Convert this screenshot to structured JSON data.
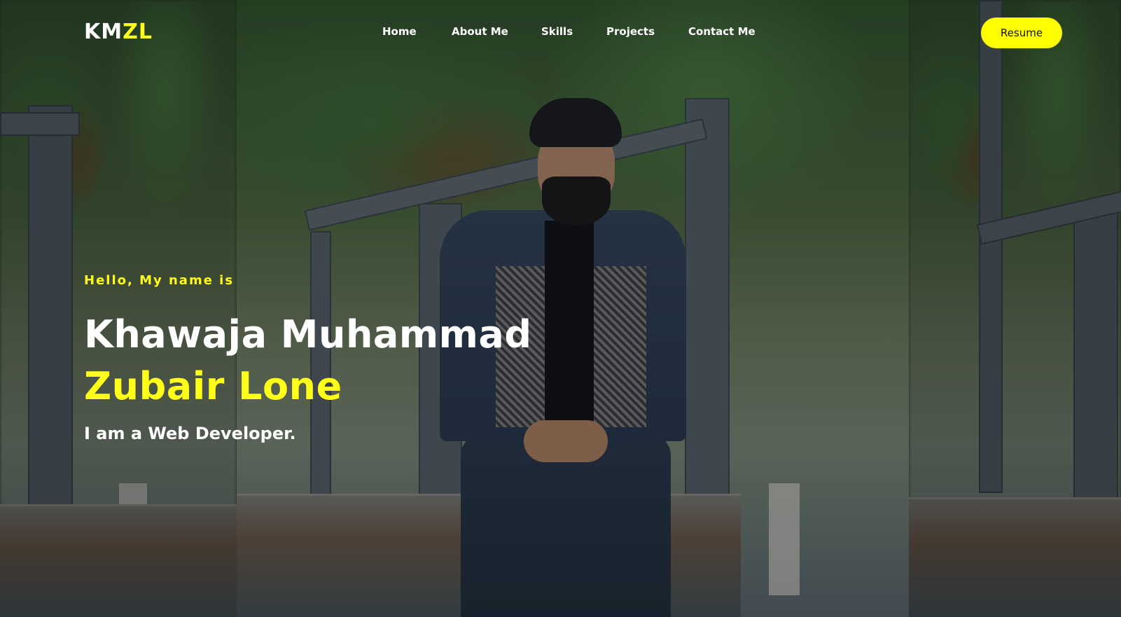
{
  "brand": {
    "logo_part1": "KM",
    "logo_part2": "ZL"
  },
  "nav": {
    "links": [
      {
        "label": "Home"
      },
      {
        "label": "About Me"
      },
      {
        "label": "Skills"
      },
      {
        "label": "Projects"
      },
      {
        "label": "Contact Me"
      }
    ],
    "resume_label": "Resume"
  },
  "hero": {
    "greeting": "Hello, My name is",
    "name_first": "Khawaja Muhammad",
    "name_last": "Zubair Lone",
    "tagline": "I am a Web Developer."
  },
  "colors": {
    "accent": "#ffff00",
    "text": "#ffffff",
    "button_text": "#111111"
  },
  "background": {
    "image": "portrait-photo-background"
  }
}
